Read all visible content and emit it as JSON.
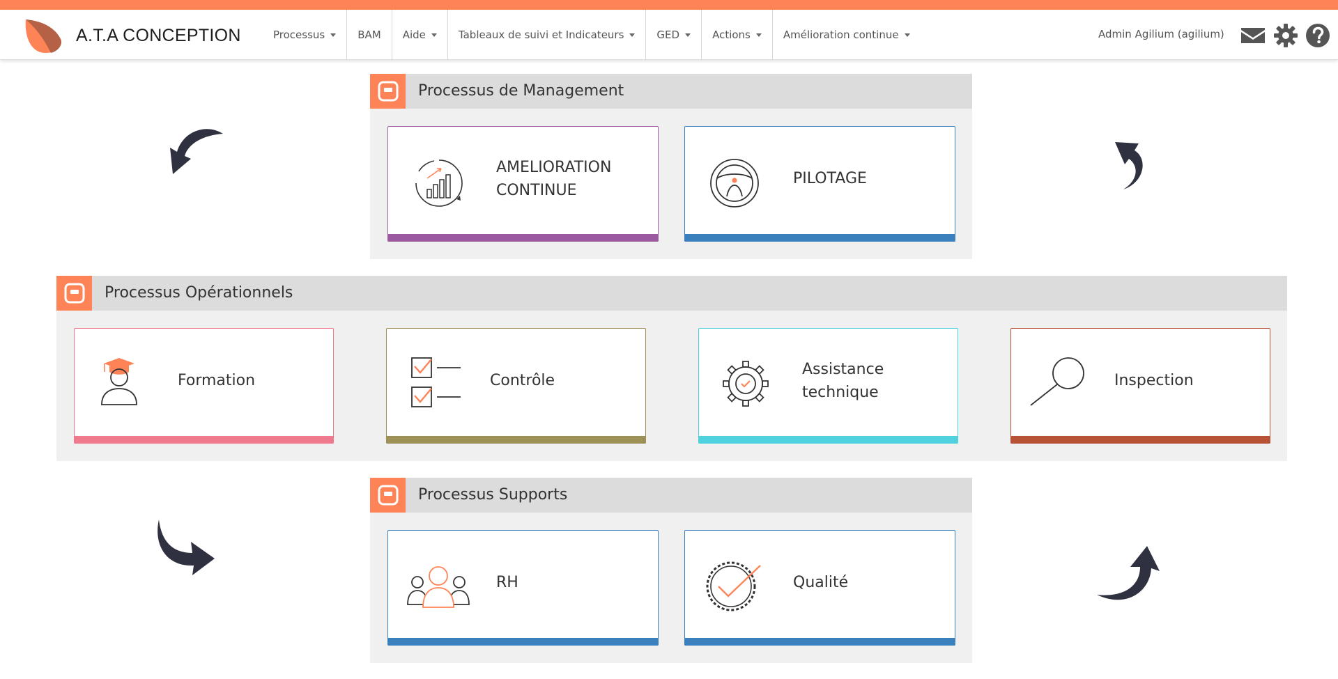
{
  "app": {
    "name": "A.T.A CONCEPTION"
  },
  "nav": {
    "items": [
      {
        "label": "Processus",
        "dropdown": true
      },
      {
        "label": "BAM",
        "dropdown": false
      },
      {
        "label": "Aide",
        "dropdown": true
      },
      {
        "label": "Tableaux de suivi et Indicateurs",
        "dropdown": true
      },
      {
        "label": "GED",
        "dropdown": true
      },
      {
        "label": "Actions",
        "dropdown": true
      },
      {
        "label": "Amélioration continue",
        "dropdown": true
      }
    ],
    "user": "Admin Agilium (agilium)",
    "icons": [
      "envelope-icon",
      "gear-icon",
      "help-icon"
    ]
  },
  "colors": {
    "accent": "#fe8458",
    "dark": "#2f3140",
    "header_bg": "#dcdcdc",
    "panel_bg": "#f0f0f0"
  },
  "management": {
    "title": "Processus de Management",
    "cards": [
      {
        "line1": "AMELIORATION",
        "line2": "CONTINUE",
        "color": "#9b5a9f",
        "icon": "improvement-chart-icon"
      },
      {
        "line1": "PILOTAGE",
        "line2": "",
        "color": "#3a80bd",
        "icon": "steering-wheel-icon"
      }
    ]
  },
  "operational": {
    "title": "Processus Opérationnels",
    "cards": [
      {
        "line1": "Formation",
        "line2": "",
        "color": "#ef7a8e",
        "icon": "graduate-icon"
      },
      {
        "line1": "Contrôle",
        "line2": "",
        "color": "#9e9158",
        "icon": "checklist-icon"
      },
      {
        "line1": "Assistance",
        "line2": "technique",
        "color": "#4fd2dd",
        "icon": "gear-check-icon"
      },
      {
        "line1": "Inspection",
        "line2": "",
        "color": "#b85237",
        "icon": "magnifier-icon"
      }
    ]
  },
  "supports": {
    "title": "Processus Supports",
    "cards": [
      {
        "line1": "RH",
        "line2": "",
        "color": "#3a80bd",
        "icon": "team-icon"
      },
      {
        "line1": "Qualité",
        "line2": "",
        "color": "#3a80bd",
        "icon": "quality-seal-icon"
      }
    ]
  }
}
